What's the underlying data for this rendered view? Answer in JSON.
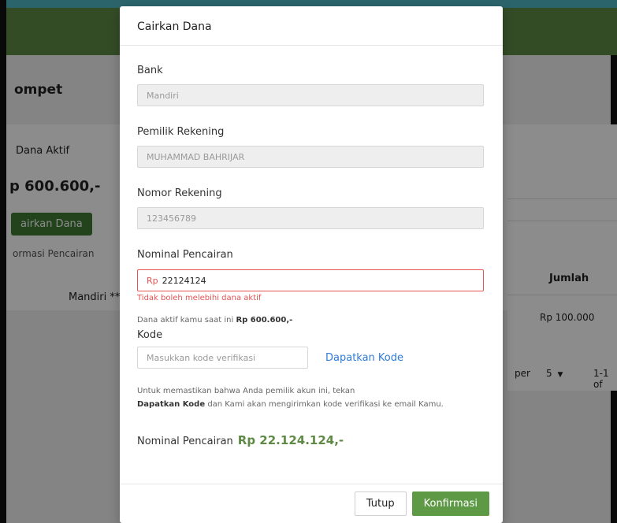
{
  "background": {
    "page_title": "ompet",
    "dana_aktif_label": "Dana Aktif",
    "dana_aktif_value": "p 600.600,-",
    "cairkan_button": "airkan Dana",
    "info_link": "ormasi Pencairan",
    "bank_row": "Mandiri ***",
    "col_jumlah": "Jumlah",
    "row_jumlah": "Rp 100.000",
    "pager_per": "per",
    "pager_size": "5",
    "pager_range": "1-1 of"
  },
  "modal": {
    "title": "Cairkan Dana",
    "bank_label": "Bank",
    "bank_value": "Mandiri",
    "owner_label": "Pemilik Rekening",
    "owner_value": "MUHAMMAD BAHRIJAR",
    "account_label": "Nomor Rekening",
    "account_value": "123456789",
    "nominal_label": "Nominal Pencairan",
    "nominal_prefix": "Rp",
    "nominal_value": "22124124",
    "nominal_error": "Tidak boleh melebihi dana aktif",
    "active_balance_text": "Dana aktif kamu saat ini",
    "active_balance_value": "Rp 600.600,-",
    "code_label": "Kode",
    "code_placeholder": "Masukkan kode verifikasi",
    "get_code_link": "Dapatkan Kode",
    "info_text_1": "Untuk memastikan bahwa Anda pemilik akun ini, tekan",
    "info_bold": "Dapatkan Kode",
    "info_text_2": "dan Kami akan mengirimkan kode verifikasi ke email Kamu.",
    "total_label": "Nominal Pencairan",
    "total_value": "Rp 22.124.124,-",
    "close_button": "Tutup",
    "confirm_button": "Konfirmasi"
  },
  "colors": {
    "brand_green": "#5e8a45",
    "error_red": "#e55353",
    "link_blue": "#2f7bd8"
  }
}
